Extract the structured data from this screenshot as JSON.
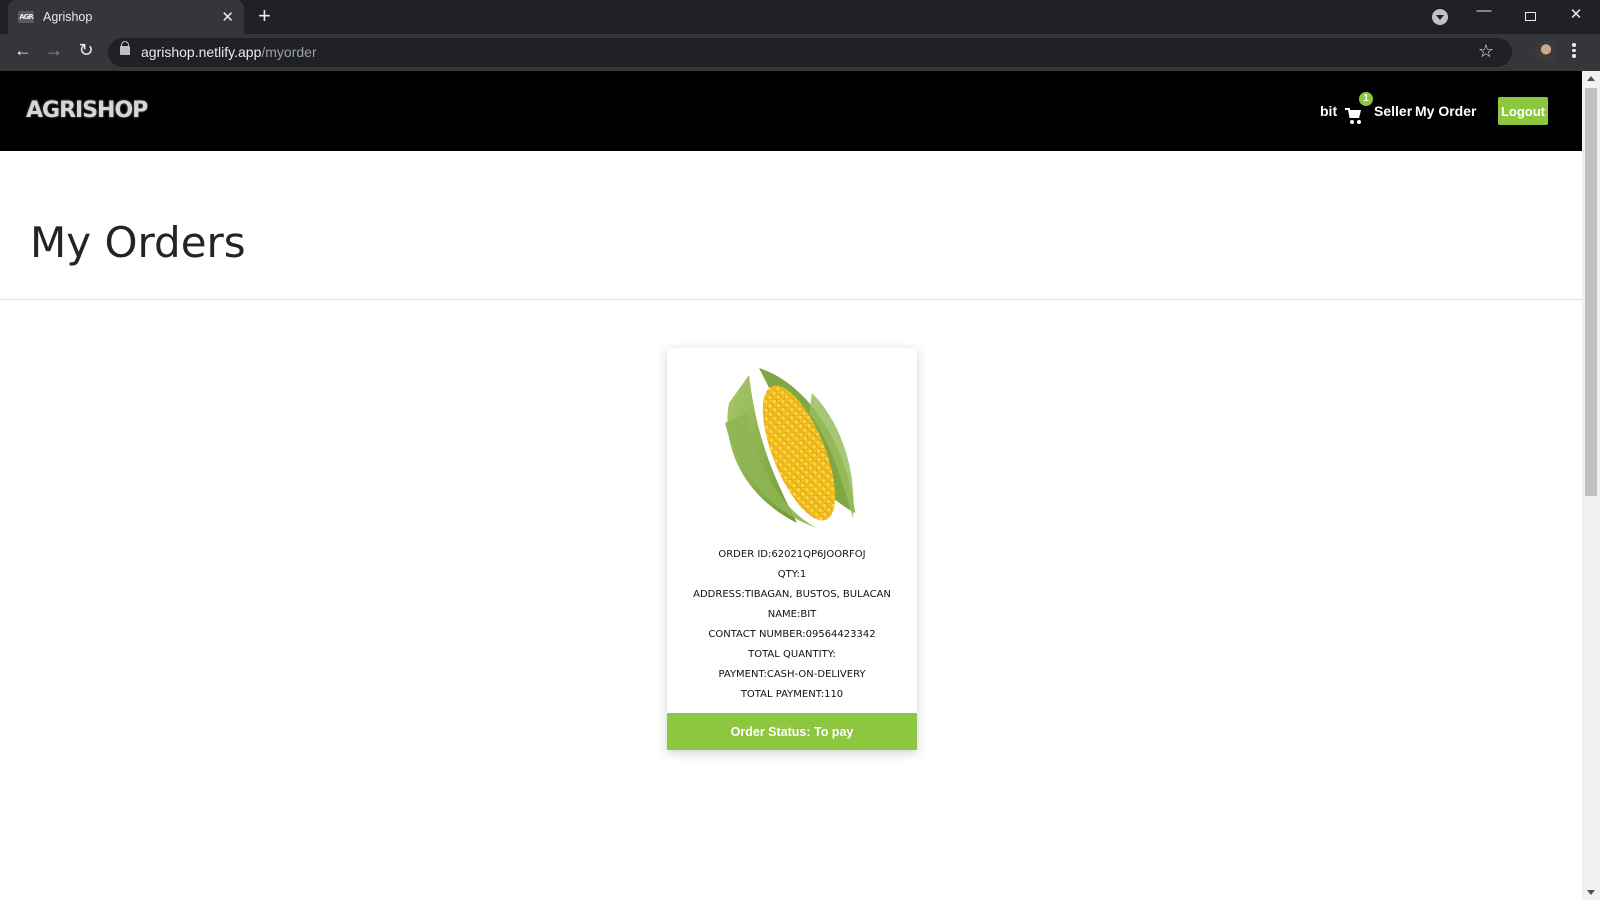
{
  "browser": {
    "tab_title": "Agrishop",
    "url_host": "agrishop.netlify.app",
    "url_path": "/myorder"
  },
  "header": {
    "logo_text": "AGRISHOP",
    "username": "bit",
    "cart_count": "1",
    "seller_label": "Seller",
    "my_order_label": "My Order",
    "logout_label": "Logout"
  },
  "page": {
    "title": "My Orders"
  },
  "order": {
    "image": "corn-cob-image",
    "order_id": "ORDER ID:62021QP6JOORFOJ",
    "qty": "QTY:1",
    "address": "ADDRESS:TIBAGAN, BUSTOS, BULACAN",
    "name": "NAME:BIT",
    "contact": "CONTACT NUMBER:09564423342",
    "total_quantity": "TOTAL QUANTITY:",
    "payment": "PAYMENT:CASH-ON-DELIVERY",
    "total_payment": "TOTAL PAYMENT:110",
    "status": "Order Status: To pay"
  },
  "colors": {
    "accent": "#8dc63f",
    "header_bg": "#000000"
  }
}
